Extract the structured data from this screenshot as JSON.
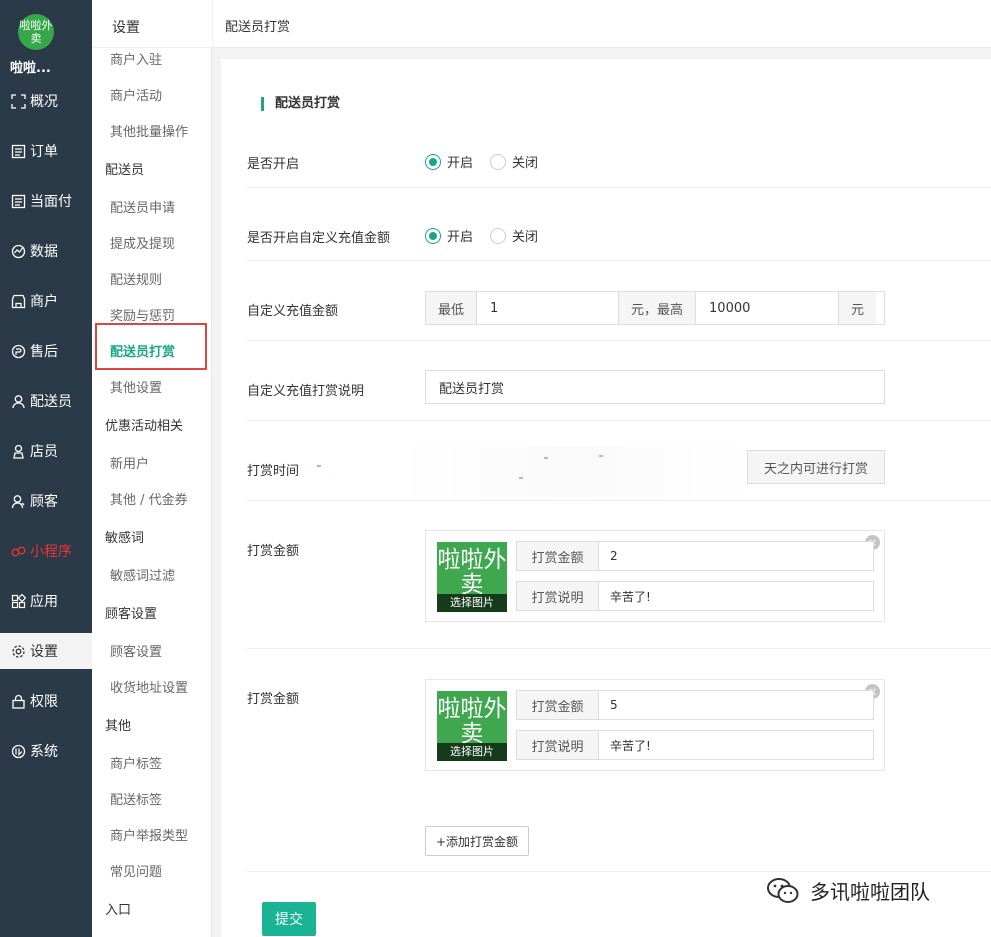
{
  "brand": {
    "logo_text": "啦啦外卖",
    "name": "啦啦..."
  },
  "nav": [
    {
      "label": "概况",
      "icon": "overview-icon"
    },
    {
      "label": "订单",
      "icon": "order-icon"
    },
    {
      "label": "当面付",
      "icon": "payment-icon"
    },
    {
      "label": "数据",
      "icon": "chart-icon"
    },
    {
      "label": "商户",
      "icon": "store-icon"
    },
    {
      "label": "售后",
      "icon": "aftersale-icon"
    },
    {
      "label": "配送员",
      "icon": "user-icon"
    },
    {
      "label": "店员",
      "icon": "clerk-icon"
    },
    {
      "label": "顾客",
      "icon": "customer-icon"
    },
    {
      "label": "小程序",
      "icon": "miniprogram-icon"
    },
    {
      "label": "应用",
      "icon": "apps-icon"
    },
    {
      "label": "设置",
      "icon": "gear-icon"
    },
    {
      "label": "权限",
      "icon": "lock-icon"
    },
    {
      "label": "系统",
      "icon": "system-icon"
    }
  ],
  "subnav": {
    "title": "设置",
    "items": [
      {
        "label": "商户入驻",
        "type": "item"
      },
      {
        "label": "商户活动",
        "type": "item"
      },
      {
        "label": "其他批量操作",
        "type": "item"
      },
      {
        "label": "配送员",
        "type": "group"
      },
      {
        "label": "配送员申请",
        "type": "item"
      },
      {
        "label": "提成及提现",
        "type": "item"
      },
      {
        "label": "配送规则",
        "type": "item"
      },
      {
        "label": "奖励与惩罚",
        "type": "item"
      },
      {
        "label": "配送员打赏",
        "type": "item"
      },
      {
        "label": "其他设置",
        "type": "item"
      },
      {
        "label": "优惠活动相关",
        "type": "group"
      },
      {
        "label": "新用户",
        "type": "item"
      },
      {
        "label": "其他 / 代金券",
        "type": "item"
      },
      {
        "label": "敏感词",
        "type": "group"
      },
      {
        "label": "敏感词过滤",
        "type": "item"
      },
      {
        "label": "顾客设置",
        "type": "group"
      },
      {
        "label": "顾客设置",
        "type": "item"
      },
      {
        "label": "收货地址设置",
        "type": "item"
      },
      {
        "label": "其他",
        "type": "group"
      },
      {
        "label": "商户标签",
        "type": "item"
      },
      {
        "label": "配送标签",
        "type": "item"
      },
      {
        "label": "商户举报类型",
        "type": "item"
      },
      {
        "label": "常见问题",
        "type": "item"
      },
      {
        "label": "入口",
        "type": "group"
      }
    ]
  },
  "header": {
    "title": "配送员打赏"
  },
  "form": {
    "section_title": "配送员打赏",
    "enable": {
      "label": "是否开启",
      "on": "开启",
      "off": "关闭",
      "value": "on"
    },
    "custom_enable": {
      "label": "是否开启自定义充值金额",
      "on": "开启",
      "off": "关闭",
      "value": "on"
    },
    "custom_amount": {
      "label": "自定义充值金额",
      "min_label": "最低",
      "min_value": "1",
      "mid_label": "元，最高",
      "max_value": "10000",
      "unit": "元"
    },
    "custom_desc": {
      "label": "自定义充值打赏说明",
      "value": "配送员打赏"
    },
    "tip_time": {
      "label": "打赏时间",
      "suffix": "天之内可进行打赏"
    },
    "tips": [
      {
        "label": "打赏金额",
        "thumb_text": "啦啦外卖",
        "pick_label": "选择图片",
        "amount_label": "打赏金额",
        "amount": "2",
        "desc_label": "打赏说明",
        "desc": "辛苦了!"
      },
      {
        "label": "打赏金额",
        "thumb_text": "啦啦外卖",
        "pick_label": "选择图片",
        "amount_label": "打赏金额",
        "amount": "5",
        "desc_label": "打赏说明",
        "desc": "辛苦了!"
      }
    ],
    "add_button": "+添加打赏金额",
    "submit_button": "提交"
  },
  "watermark": {
    "text": "多讯啦啦团队"
  },
  "colors": {
    "accent": "#1ab394",
    "nav_bg": "#2b3a48",
    "highlight_border": "#e0443b"
  }
}
